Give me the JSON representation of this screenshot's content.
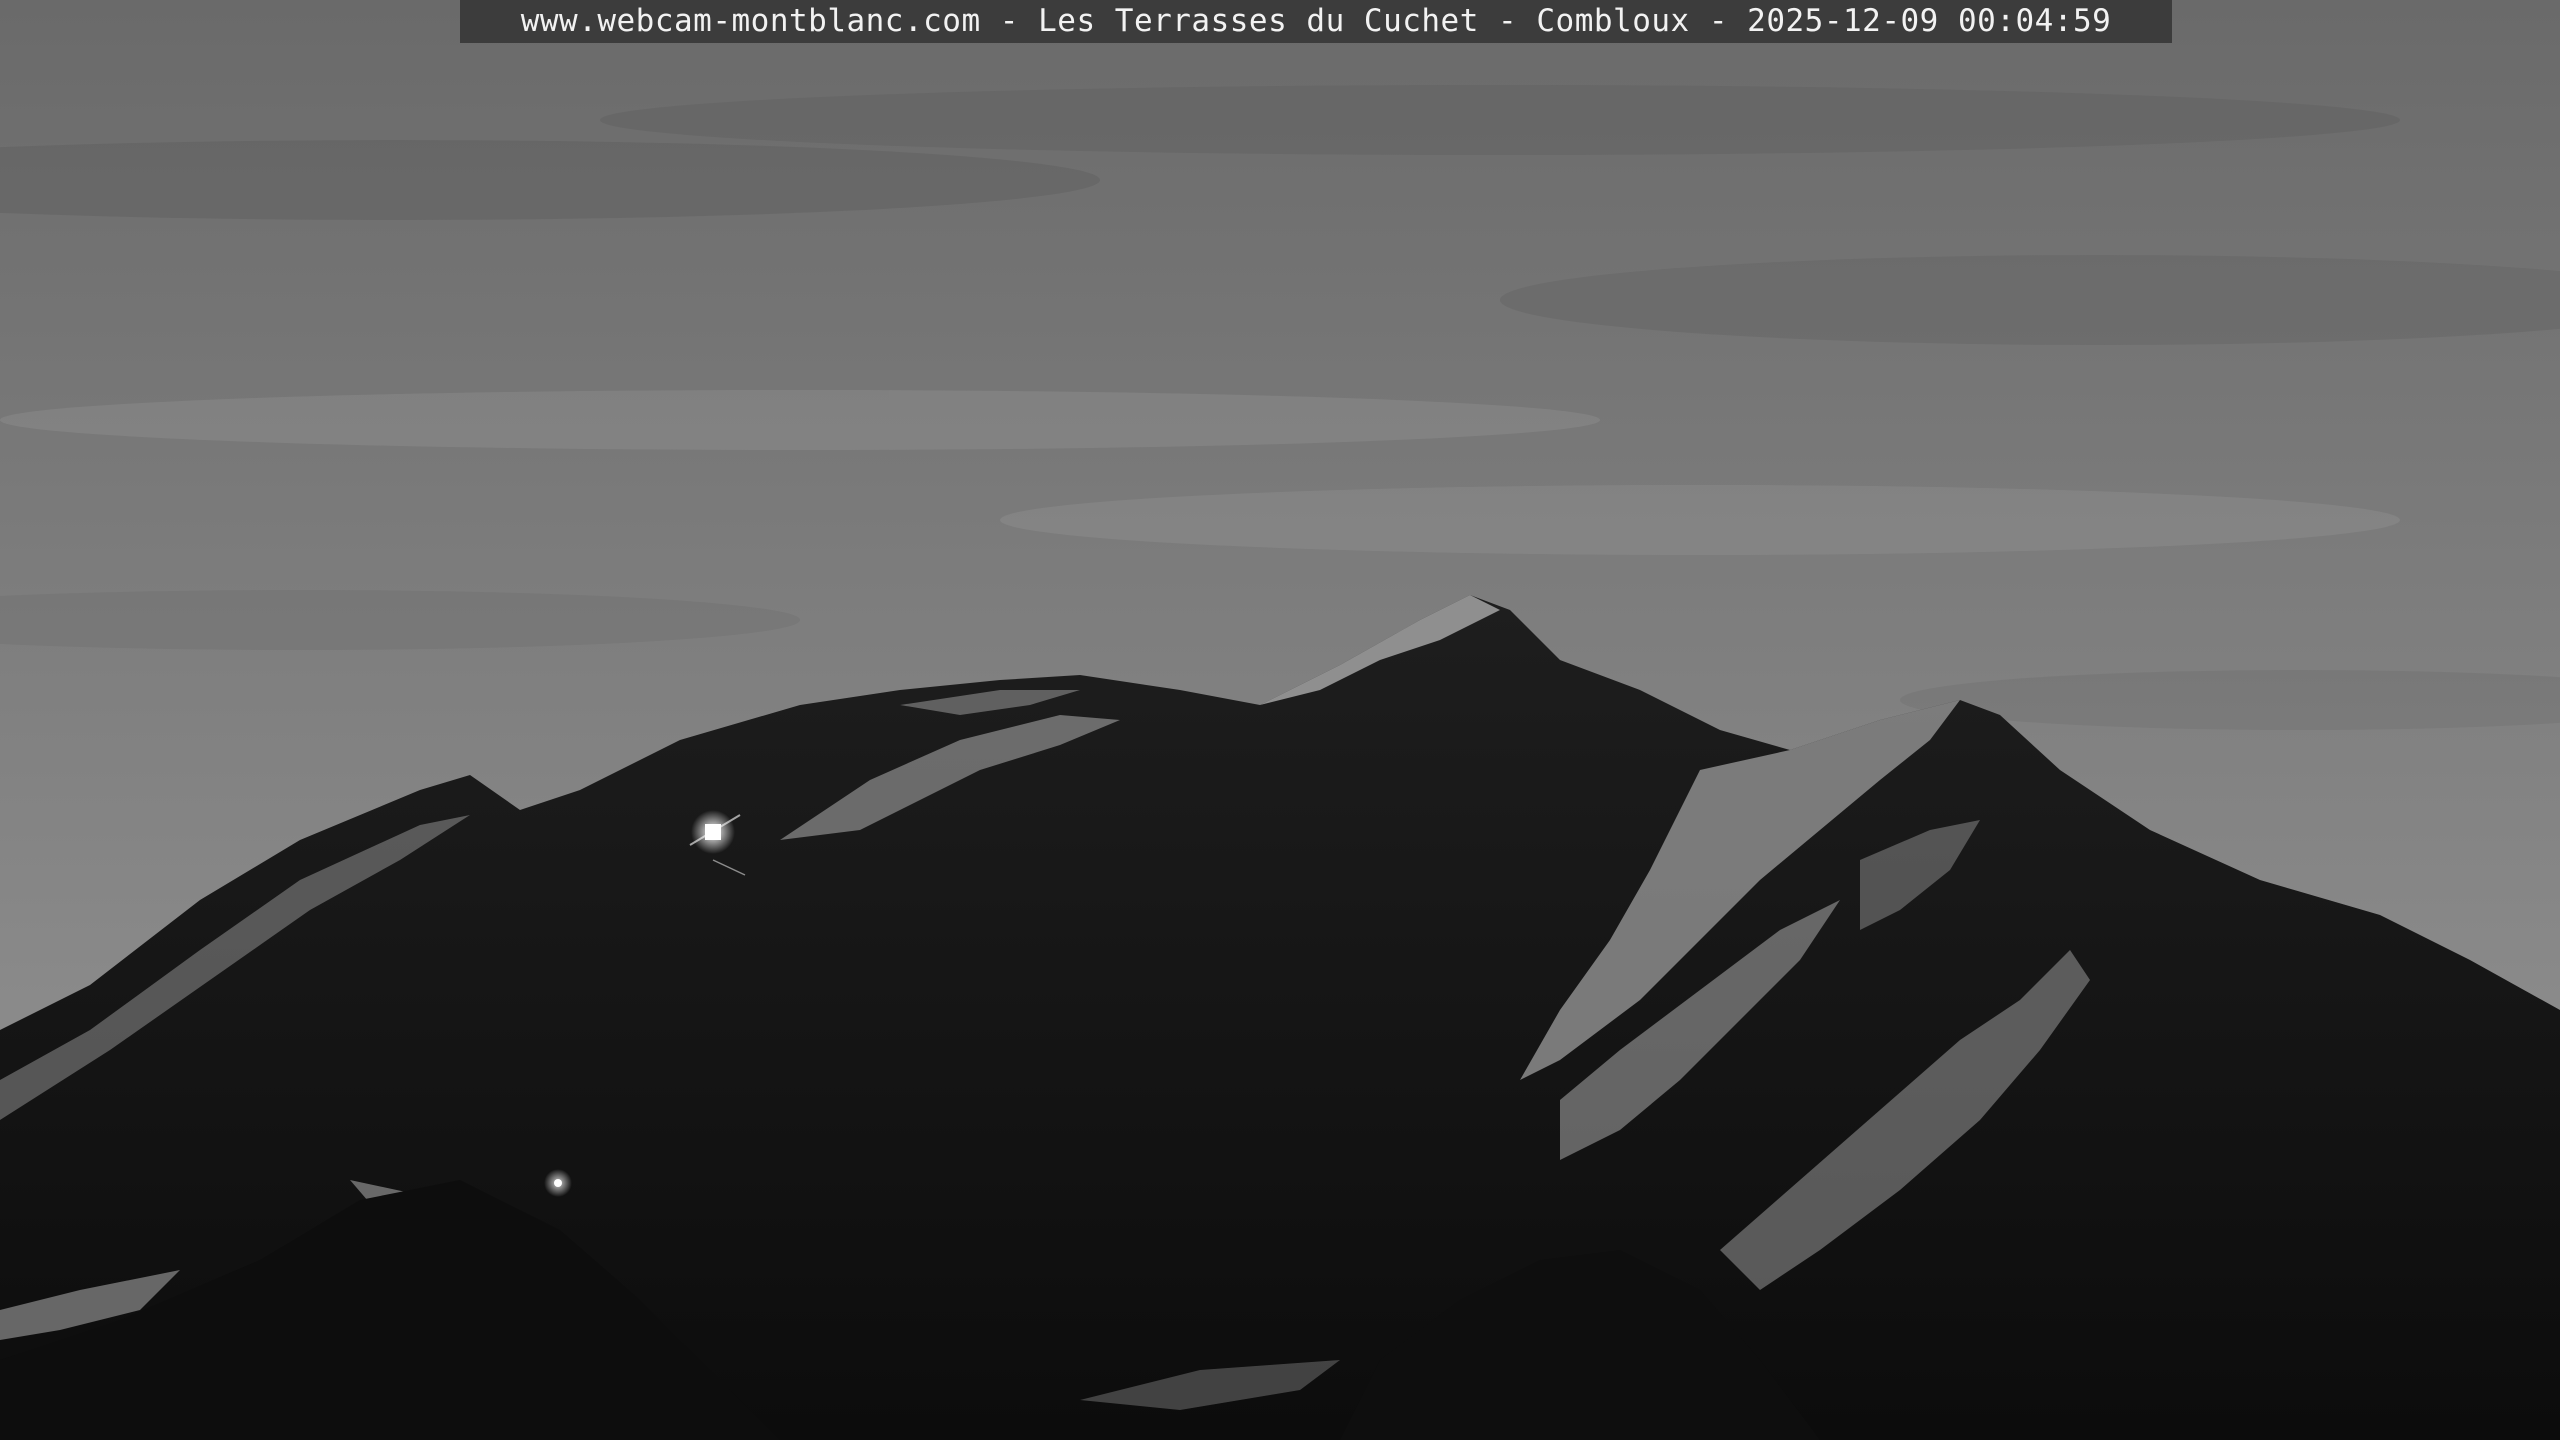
{
  "webcam": {
    "caption": "www.webcam-montblanc.com - Les Terrasses du Cuchet - Combloux - 2025-12-09 00:04:59"
  },
  "colors": {
    "sky_top": "#6a6a6a",
    "sky_bottom": "#8a8a8a",
    "mountain_dark": "#141414",
    "snow_highlight": "#a8a8a8",
    "caption_bg": "#3c3c3c",
    "caption_text": "#f2f2f2"
  }
}
